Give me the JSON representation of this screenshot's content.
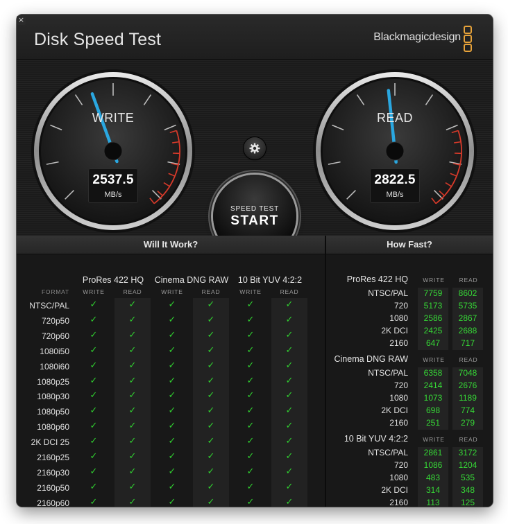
{
  "window": {
    "title": "Disk Speed Test",
    "brand": "Blackmagicdesign",
    "close_glyph": "×",
    "brand_color": "#e8a33a"
  },
  "gauges": {
    "write": {
      "label": "WRITE",
      "value": "2537.5",
      "unit": "MB/s"
    },
    "read": {
      "label": "READ",
      "value": "2822.5",
      "unit": "MB/s"
    }
  },
  "controls": {
    "settings_icon": "gear-icon",
    "start_top": "SPEED TEST",
    "start_main": "START"
  },
  "will_it_work": {
    "header": "Will It Work?",
    "format_label": "FORMAT",
    "write_label": "WRITE",
    "read_label": "READ",
    "formats": [
      "ProRes 422 HQ",
      "Cinema DNG RAW",
      "10 Bit YUV 4:2:2"
    ],
    "rows": [
      "NTSC/PAL",
      "720p50",
      "720p60",
      "1080i50",
      "1080i60",
      "1080p25",
      "1080p30",
      "1080p50",
      "1080p60",
      "2K DCI 25",
      "2160p25",
      "2160p30",
      "2160p50",
      "2160p60"
    ],
    "check_glyph": "✓",
    "check_color": "#30d030"
  },
  "how_fast": {
    "header": "How Fast?",
    "write_label": "WRITE",
    "read_label": "READ",
    "groups": [
      {
        "title": "ProRes 422 HQ",
        "rows": [
          {
            "label": "NTSC/PAL",
            "write": "7759",
            "read": "8602"
          },
          {
            "label": "720",
            "write": "5173",
            "read": "5735"
          },
          {
            "label": "1080",
            "write": "2586",
            "read": "2867"
          },
          {
            "label": "2K DCI",
            "write": "2425",
            "read": "2688"
          },
          {
            "label": "2160",
            "write": "647",
            "read": "717"
          }
        ]
      },
      {
        "title": "Cinema DNG RAW",
        "rows": [
          {
            "label": "NTSC/PAL",
            "write": "6358",
            "read": "7048"
          },
          {
            "label": "720",
            "write": "2414",
            "read": "2676"
          },
          {
            "label": "1080",
            "write": "1073",
            "read": "1189"
          },
          {
            "label": "2K DCI",
            "write": "698",
            "read": "774"
          },
          {
            "label": "2160",
            "write": "251",
            "read": "279"
          }
        ]
      },
      {
        "title": "10 Bit YUV 4:2:2",
        "rows": [
          {
            "label": "NTSC/PAL",
            "write": "2861",
            "read": "3172"
          },
          {
            "label": "720",
            "write": "1086",
            "read": "1204"
          },
          {
            "label": "1080",
            "write": "483",
            "read": "535"
          },
          {
            "label": "2K DCI",
            "write": "314",
            "read": "348"
          },
          {
            "label": "2160",
            "write": "113",
            "read": "125"
          }
        ]
      }
    ]
  }
}
